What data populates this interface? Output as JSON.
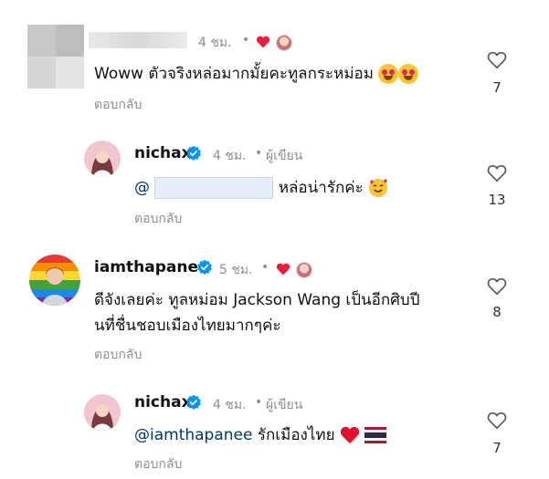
{
  "comments": [
    {
      "username": "",
      "time": "4 ชม.",
      "dot": "•",
      "text": "Woww ตัวจริงหล่อมากมั้ยคะทูลกระหม่อม",
      "reply_label": "ตอบกลับ",
      "like_count": "7"
    },
    {
      "username": "nichax",
      "time": "4 ชม.",
      "dot": "•",
      "author_label": "ผู้เขียน",
      "mention": "@",
      "text": "หล่อน่ารักค่ะ",
      "reply_label": "ตอบกลับ",
      "like_count": "13"
    },
    {
      "username": "iamthapanee",
      "time": "5 ชม.",
      "dot": "•",
      "text_line1": "ดีจังเลยค่ะ ทูลหม่อม Jackson Wang เป็นอีกศิบปี",
      "text_line2": "นที่ชื่นชอบเมืองไทยมากๆค่ะ",
      "reply_label": "ตอบกลับ",
      "like_count": "8"
    },
    {
      "username": "nichax",
      "time": "4 ชม.",
      "dot": "•",
      "author_label": "ผู้เขียน",
      "mention": "@iamthapanee",
      "text": "รักเมืองไทย",
      "reply_label": "ตอบกลับ",
      "like_count": "7"
    }
  ],
  "colors": {
    "verified": "#0095f6",
    "heart_red": "#ed1c3b",
    "mention": "#00376b",
    "muted": "#8e8e8e"
  }
}
